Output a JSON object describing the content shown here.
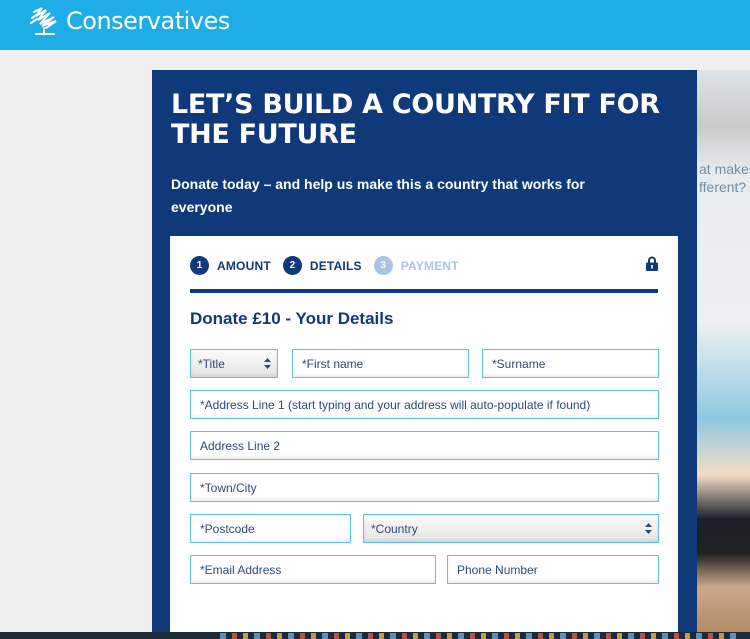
{
  "header": {
    "brand": "Conservatives",
    "logo_icon": "tree-logo-icon",
    "background": "#1fade8"
  },
  "background_photo": {
    "overlay_text": [
      "at makes",
      "fferent?"
    ]
  },
  "hero": {
    "headline": "LET’S BUILD A COUNTRY FIT FOR THE FUTURE",
    "subtext": "Donate today – and help us make this a country that works for everyone",
    "panel_color": "#10397a"
  },
  "steps": [
    {
      "number": "1",
      "label": "AMOUNT",
      "state": "complete"
    },
    {
      "number": "2",
      "label": "DETAILS",
      "state": "active"
    },
    {
      "number": "3",
      "label": "PAYMENT",
      "state": "inactive"
    }
  ],
  "secure_icon": "lock-icon",
  "form": {
    "title": "Donate £10 - Your Details",
    "title_select": {
      "value": "*Title"
    },
    "first_name": {
      "placeholder": "*First name"
    },
    "surname": {
      "placeholder": "*Surname"
    },
    "address1": {
      "placeholder": "*Address Line 1 (start typing and your address will auto-populate if found)"
    },
    "address2": {
      "placeholder": "Address Line 2"
    },
    "town": {
      "placeholder": "*Town/City"
    },
    "postcode": {
      "placeholder": "*Postcode"
    },
    "country_select": {
      "value": "*Country"
    },
    "email": {
      "placeholder": "*Email Address"
    },
    "phone": {
      "placeholder": "Phone Number"
    }
  }
}
